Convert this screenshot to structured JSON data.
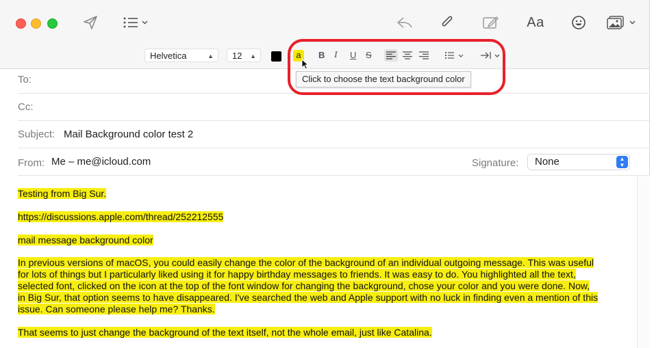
{
  "toolbar": {
    "buttons": [
      {
        "name": "send-icon"
      },
      {
        "name": "header-fields-icon"
      },
      {
        "name": "reply-icon"
      },
      {
        "name": "attachment-icon"
      },
      {
        "name": "markup-icon"
      },
      {
        "name": "format-icon",
        "label": "Aa"
      },
      {
        "name": "emoji-icon"
      },
      {
        "name": "photo-browser-icon"
      }
    ]
  },
  "formatbar": {
    "font": "Helvetica",
    "size": "12",
    "text_color": "#000000",
    "highlight_label": "a",
    "highlight_color": "#f5e800",
    "bold": "B",
    "italic": "I",
    "underline": "U",
    "strike": "S",
    "tooltip": "Click to choose the text background color"
  },
  "header": {
    "to_label": "To:",
    "cc_label": "Cc:",
    "subject_label": "Subject:",
    "subject_value": "Mail Background color test 2",
    "from_label": "From:",
    "from_value": "Me – me@icloud.com",
    "signature_label": "Signature:",
    "signature_value": "None"
  },
  "body": {
    "highlight_color": "#f7ee11",
    "p1": "Testing from Big Sur.",
    "p2": "https://discussions.apple.com/thread/252212555",
    "p3": "mail message background color",
    "p4_lines": [
      "In previous versions of macOS, you could easily change the color of the background of an individual outgoing message.  This was useful",
      "for lots of things but I particularly liked using it for happy birthday messages to friends.  It was easy to do.  You highlighted all the text,",
      "selected font, clicked on the icon at the top of the font window for changing the background, chose your color and you were done.  Now,",
      "in Big Sur, that option seems to have disappeared.  I've searched the web and Apple support with no luck in finding even a mention of this",
      "issue.  Can someone please help me?  Thanks."
    ],
    "p5": "That seems to just change the background of the text itself, not the whole email, just like Catalina."
  }
}
